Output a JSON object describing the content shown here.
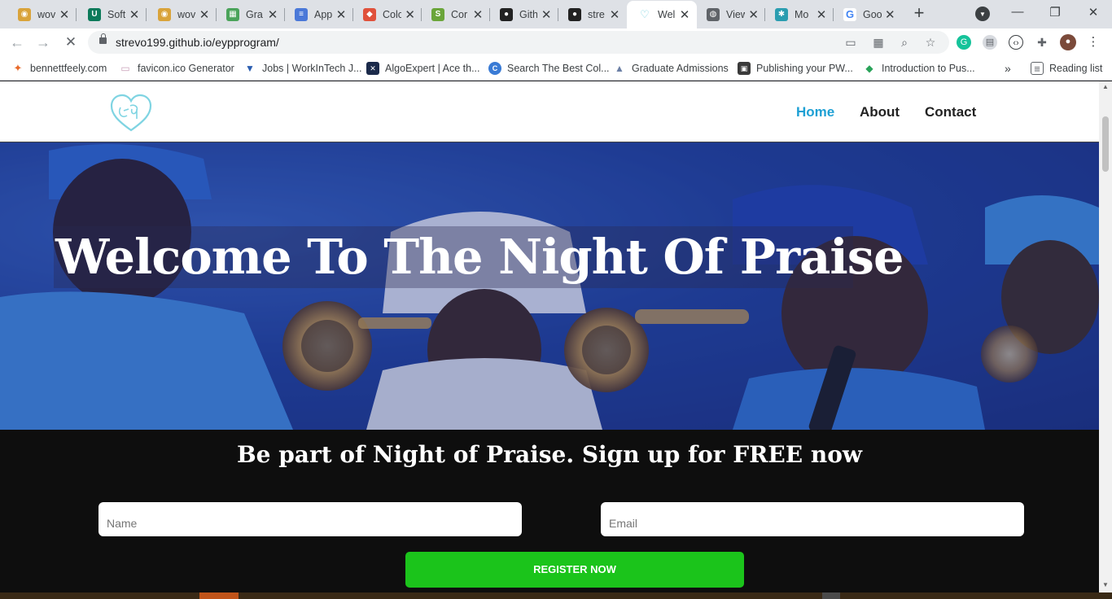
{
  "tabs": [
    {
      "title": "wov",
      "color": "#d9a33a",
      "glyph": "◉",
      "active": false
    },
    {
      "title": "Soft",
      "color": "#0c7a5a",
      "glyph": "U",
      "active": false
    },
    {
      "title": "wov",
      "color": "#d9a33a",
      "glyph": "◉",
      "active": false
    },
    {
      "title": "Gra",
      "color": "#4aa35a",
      "glyph": "▦",
      "active": false
    },
    {
      "title": "App",
      "color": "#4a78d8",
      "glyph": "≡",
      "active": false
    },
    {
      "title": "Colo",
      "color": "#e0513b",
      "glyph": "◆",
      "active": false
    },
    {
      "title": "Cor",
      "color": "#6aa53a",
      "glyph": "S",
      "active": false
    },
    {
      "title": "Gith",
      "color": "#222222",
      "glyph": "●",
      "active": false
    },
    {
      "title": "stre",
      "color": "#222222",
      "glyph": "●",
      "active": false
    },
    {
      "title": "Wel",
      "color": "#7fd4e2",
      "glyph": "♡",
      "active": true
    },
    {
      "title": "View",
      "color": "#5f6368",
      "glyph": "◍",
      "active": false
    },
    {
      "title": "Mo",
      "color": "#2a9db0",
      "glyph": "✱",
      "active": false
    },
    {
      "title": "Goo",
      "color": "#4285f4",
      "glyph": "G",
      "active": false
    }
  ],
  "window_controls": {
    "minimize": "—",
    "restore": "❐",
    "close": "✕"
  },
  "address": {
    "url": "strevo199.github.io/eypprogram/"
  },
  "bookmarks": [
    {
      "label": "bennettfeely.com",
      "color": "#e86a2a",
      "glyph": "✦"
    },
    {
      "label": "favicon.ico Generator",
      "color": "#c9a0b8",
      "glyph": "▭"
    },
    {
      "label": "Jobs | WorkInTech J...",
      "color": "#2a5db0",
      "glyph": "▼"
    },
    {
      "label": "AlgoExpert | Ace th...",
      "color": "#1b2a4a",
      "glyph": "✕"
    },
    {
      "label": "Search The Best Col...",
      "color": "#3a7bd5",
      "glyph": "C"
    },
    {
      "label": "Graduate Admissions",
      "color": "#6b7fa5",
      "glyph": "▲"
    },
    {
      "label": "Publishing your PW...",
      "color": "#3a3a3a",
      "glyph": "▣"
    },
    {
      "label": "Introduction to Pus...",
      "color": "#ffffff",
      "glyph": "◆"
    }
  ],
  "bookmarks_more": "»",
  "reading_list": "Reading list",
  "site": {
    "nav": [
      {
        "label": "Home",
        "active": true
      },
      {
        "label": "About",
        "active": false
      },
      {
        "label": "Contact",
        "active": false
      }
    ],
    "hero_title": "Welcome To The Night Of Praise",
    "signup_heading": "Be part of Night of Praise. Sign up for FREE now",
    "name_placeholder": "Name",
    "email_placeholder": "Email",
    "register_label": "REGISTER NOW"
  },
  "colors": {
    "accent_link": "#1ea0d4",
    "register_button": "#1bc41b",
    "signup_bg": "#0e0e0e"
  }
}
